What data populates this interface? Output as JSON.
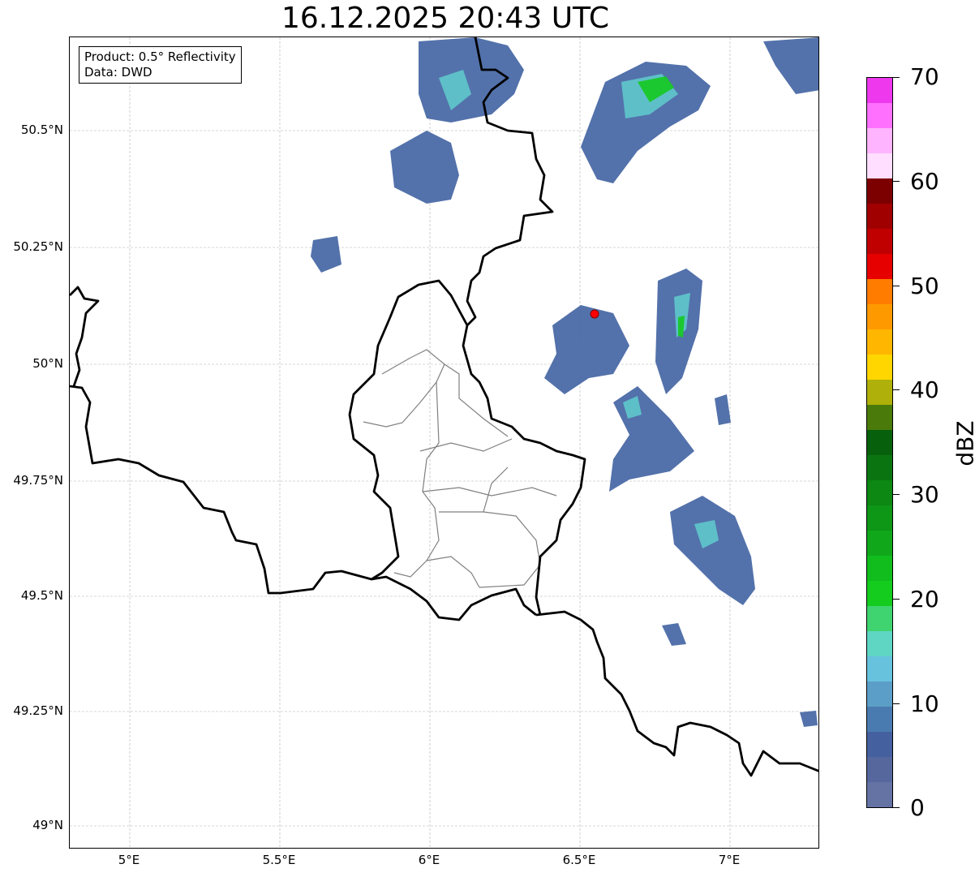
{
  "title": "16.12.2025 20:43 UTC",
  "info_box": {
    "line1": "Product: 0.5° Reflectivity",
    "line2": "Data: DWD"
  },
  "axes": {
    "x_ticks": [
      "5°E",
      "5.5°E",
      "6°E",
      "6.5°E",
      "7°E"
    ],
    "y_ticks": [
      "50.5°N",
      "50.25°N",
      "50°N",
      "49.75°N",
      "49.5°N",
      "49.25°N",
      "49°N"
    ],
    "lon_range": [
      4.8,
      7.3
    ],
    "lat_range": [
      48.95,
      50.7
    ],
    "grid": true
  },
  "colorbar": {
    "label": "dBZ",
    "ticks": [
      "0",
      "10",
      "20",
      "30",
      "40",
      "50",
      "60",
      "70"
    ],
    "range": [
      0,
      70
    ],
    "colors": [
      "#6472a4",
      "#55679d",
      "#45609f",
      "#4a7bb0",
      "#5b9ec8",
      "#67c2de",
      "#5fd6c4",
      "#3fd46f",
      "#13cc1e",
      "#10bd1c",
      "#10a81a",
      "#0e9616",
      "#0c8813",
      "#0a7510",
      "#07600c",
      "#4a7a0a",
      "#b0b00a",
      "#ffd600",
      "#ffb600",
      "#ff9900",
      "#ff7c00",
      "#e60000",
      "#c00000",
      "#a00000",
      "#7c0000",
      "#ffdeff",
      "#ffb4ff",
      "#ff70ff",
      "#ee38ee"
    ]
  },
  "marker": {
    "lon": 6.55,
    "lat": 50.11,
    "color": "#ff0000"
  },
  "colors": {
    "border_major": "#000000",
    "border_minor": "#808080",
    "grid": "#b0b0b0",
    "echo_low": "#4a6aa6",
    "echo_mid": "#5fc8cc",
    "echo_high": "#18c828"
  }
}
